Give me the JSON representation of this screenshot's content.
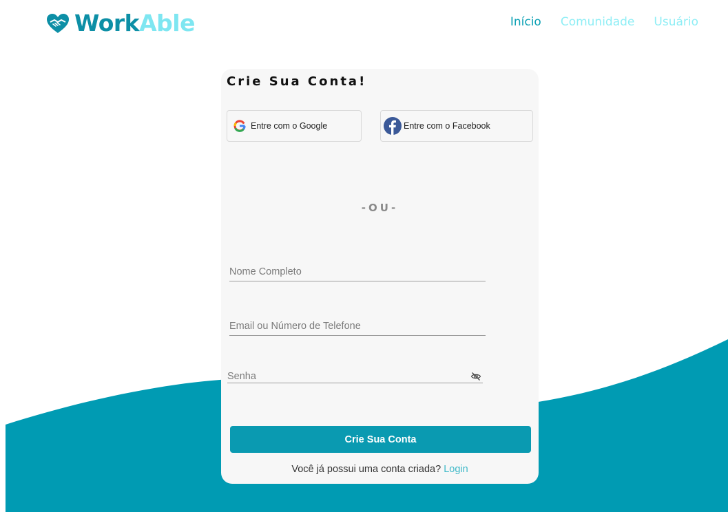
{
  "brand": {
    "name_part1": "Work",
    "name_part2": "Able",
    "icon": "heart-handshake-icon",
    "colors": {
      "primary": "#0d8fa6",
      "light": "#7ee6f1"
    }
  },
  "nav": {
    "items": [
      {
        "label": "Início",
        "active": true
      },
      {
        "label": "Comunidade",
        "active": false
      },
      {
        "label": "Usuário",
        "active": false
      }
    ]
  },
  "card": {
    "title": "Crie Sua Conta!",
    "google_label": "Entre com o Google",
    "google_icon": "google-icon",
    "facebook_label": "Entre com o Facebook",
    "facebook_icon": "facebook-icon",
    "divider": "-OU-",
    "fields": {
      "name_placeholder": "Nome Completo",
      "email_placeholder": "Email ou Número de Telefone",
      "password_placeholder": "Senha",
      "password_toggle_icon": "eye-off-icon"
    },
    "submit_label": "Crie Sua Conta",
    "footer_text": "Você já possui uma conta criada?",
    "footer_link": "Login"
  },
  "colors": {
    "accent": "#0a9ab1",
    "nav_active": "#0aa0b4",
    "nav_inactive": "#8feef5",
    "card_bg": "#f7f7f7",
    "wave": "#009bb3"
  }
}
